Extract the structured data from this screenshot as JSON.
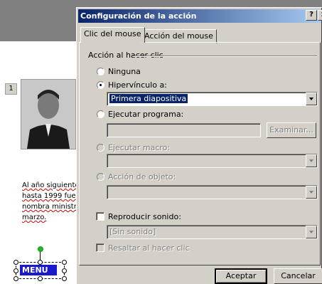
{
  "slide": {
    "number": "1",
    "text_lines": [
      "Al año siguiente",
      "hasta 1999 fue",
      "nombra ministr",
      "marzo."
    ],
    "menu_label": "MENU"
  },
  "dialog": {
    "title": "Configuración de la acción",
    "help_glyph": "?",
    "close_glyph": "x",
    "tabs": [
      {
        "label": "Clic del mouse",
        "active": true
      },
      {
        "label": "Acción del mouse",
        "active": false
      }
    ],
    "group_title": "Acción al hacer clic",
    "options": {
      "none": {
        "label": "Ninguna",
        "checked": false
      },
      "hyperlink": {
        "label": "Hipervínculo a:",
        "checked": true
      },
      "hyperlink_value": "Primera diapositiva",
      "run_program": {
        "label": "Ejecutar programa:",
        "checked": false
      },
      "run_program_value": "",
      "browse_label": "Examinar...",
      "run_macro": {
        "label": "Ejecutar macro:",
        "enabled": false
      },
      "object_action": {
        "label": "Acción de objeto:",
        "enabled": false
      }
    },
    "play_sound": {
      "label": "Reproducir sonido:",
      "checked": false
    },
    "sound_value": "[Sin sonido]",
    "highlight": {
      "label": "Resaltar al hacer clic",
      "enabled": false
    },
    "ok_label": "Aceptar",
    "cancel_label": "Cancelar"
  }
}
